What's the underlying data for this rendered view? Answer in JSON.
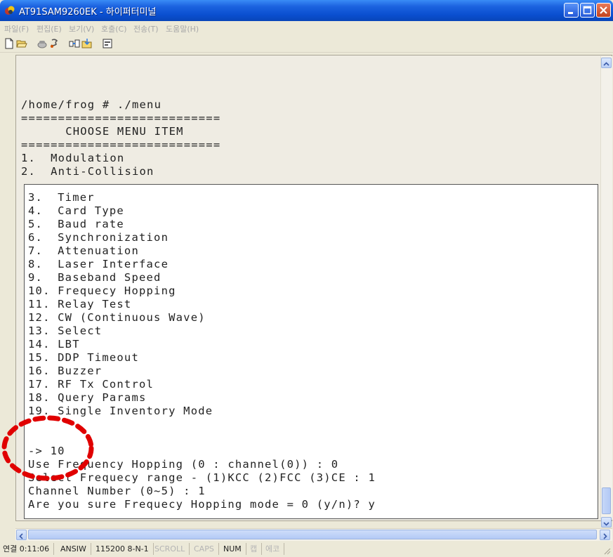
{
  "window": {
    "title": "AT91SAM9260EK - 하이퍼터미널"
  },
  "menu": [
    "파일(F)",
    "편집(E)",
    "보기(V)",
    "호출(C)",
    "전송(T)",
    "도움말(H)"
  ],
  "toolbar_icons": [
    "new-icon",
    "open-icon",
    "call-icon",
    "disconnect-icon",
    "send-icon",
    "receive-icon",
    "properties-icon"
  ],
  "terminal": {
    "upper_lines": [
      "/home/frog # ./menu",
      "===========================",
      "      CHOOSE MENU ITEM",
      "===========================",
      "1.  Modulation",
      "2.  Anti-Collision"
    ],
    "lower_lines": [
      "3.  Timer",
      "4.  Card Type",
      "5.  Baud rate",
      "6.  Synchronization",
      "7.  Attenuation",
      "8.  Laser Interface",
      "9.  Baseband Speed",
      "10. Frequecy Hopping",
      "11. Relay Test",
      "12. CW (Continuous Wave)",
      "13. Select",
      "14. LBT",
      "15. DDP Timeout",
      "16. Buzzer",
      "17. RF Tx Control",
      "18. Query Params",
      "19. Single Inventory Mode",
      "",
      "",
      "-> 10",
      "Use Frequency Hopping (0 : channel(0)) : 0",
      "Select Frequecy range - (1)KCC (2)FCC (3)CE : 1",
      "Channel Number (0~5) : 1",
      "Are you sure Frequecy Hopping mode = 0 (y/n)? y"
    ]
  },
  "status": {
    "connected": "연결 0:11:06",
    "emulation": "ANSIW",
    "port": "115200 8-N-1",
    "scroll": "SCROLL",
    "caps": "CAPS",
    "num": "NUM",
    "capture": "캡",
    "echo": "에코"
  },
  "colors": {
    "titlebar": "#0a4fd0",
    "annotation": "#e00000",
    "chrome": "#ece9d8"
  }
}
